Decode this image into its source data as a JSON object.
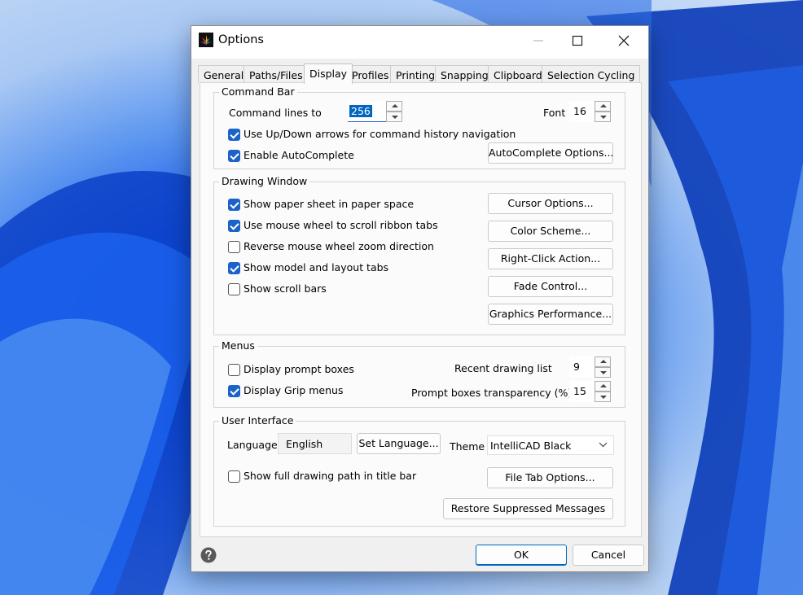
{
  "window": {
    "title": "Options"
  },
  "tabs": [
    {
      "label": "General"
    },
    {
      "label": "Paths/Files"
    },
    {
      "label": "Display"
    },
    {
      "label": "Profiles"
    },
    {
      "label": "Printing"
    },
    {
      "label": "Snapping"
    },
    {
      "label": "Clipboard"
    },
    {
      "label": "Selection Cycling"
    }
  ],
  "active_tab": "Display",
  "command_bar": {
    "title": "Command Bar",
    "command_lines_label": "Command lines to",
    "command_lines_value": "256",
    "font_label": "Font",
    "font_value": "16",
    "use_arrows": {
      "label": "Use Up/Down arrows for command history navigation",
      "checked": true
    },
    "autocomplete": {
      "label": "Enable AutoComplete",
      "checked": true
    },
    "autocomplete_options_button": "AutoComplete Options..."
  },
  "drawing_window": {
    "title": "Drawing Window",
    "checkboxes": [
      {
        "label": "Show paper sheet in paper space",
        "checked": true
      },
      {
        "label": "Use mouse wheel to scroll ribbon tabs",
        "checked": true
      },
      {
        "label": "Reverse mouse wheel zoom direction",
        "checked": false
      },
      {
        "label": "Show model and layout tabs",
        "checked": true
      },
      {
        "label": "Show scroll bars",
        "checked": false
      }
    ],
    "buttons": [
      "Cursor Options...",
      "Color Scheme...",
      "Right-Click Action...",
      "Fade Control...",
      "Graphics Performance..."
    ]
  },
  "menus": {
    "title": "Menus",
    "display_prompt_boxes": {
      "label": "Display prompt boxes",
      "checked": false
    },
    "display_grip_menus": {
      "label": "Display Grip menus",
      "checked": true
    },
    "recent_drawing_label": "Recent drawing list",
    "recent_drawing_value": "9",
    "prompt_transparency_label": "Prompt boxes transparency (%):",
    "prompt_transparency_value": "15"
  },
  "user_interface": {
    "title": "User Interface",
    "language_label": "Language",
    "language_value": "English",
    "set_language_button": "Set Language...",
    "theme_label": "Theme",
    "theme_value": "IntelliCAD Black",
    "show_full_path": {
      "label": "Show full drawing path in title bar",
      "checked": false
    },
    "file_tab_options_button": "File Tab Options...",
    "restore_messages_button": "Restore Suppressed Messages"
  },
  "footer": {
    "ok_label": "OK",
    "cancel_label": "Cancel"
  },
  "colors": {
    "accent": "#0067c0",
    "checkbox": "#1b63c9"
  }
}
